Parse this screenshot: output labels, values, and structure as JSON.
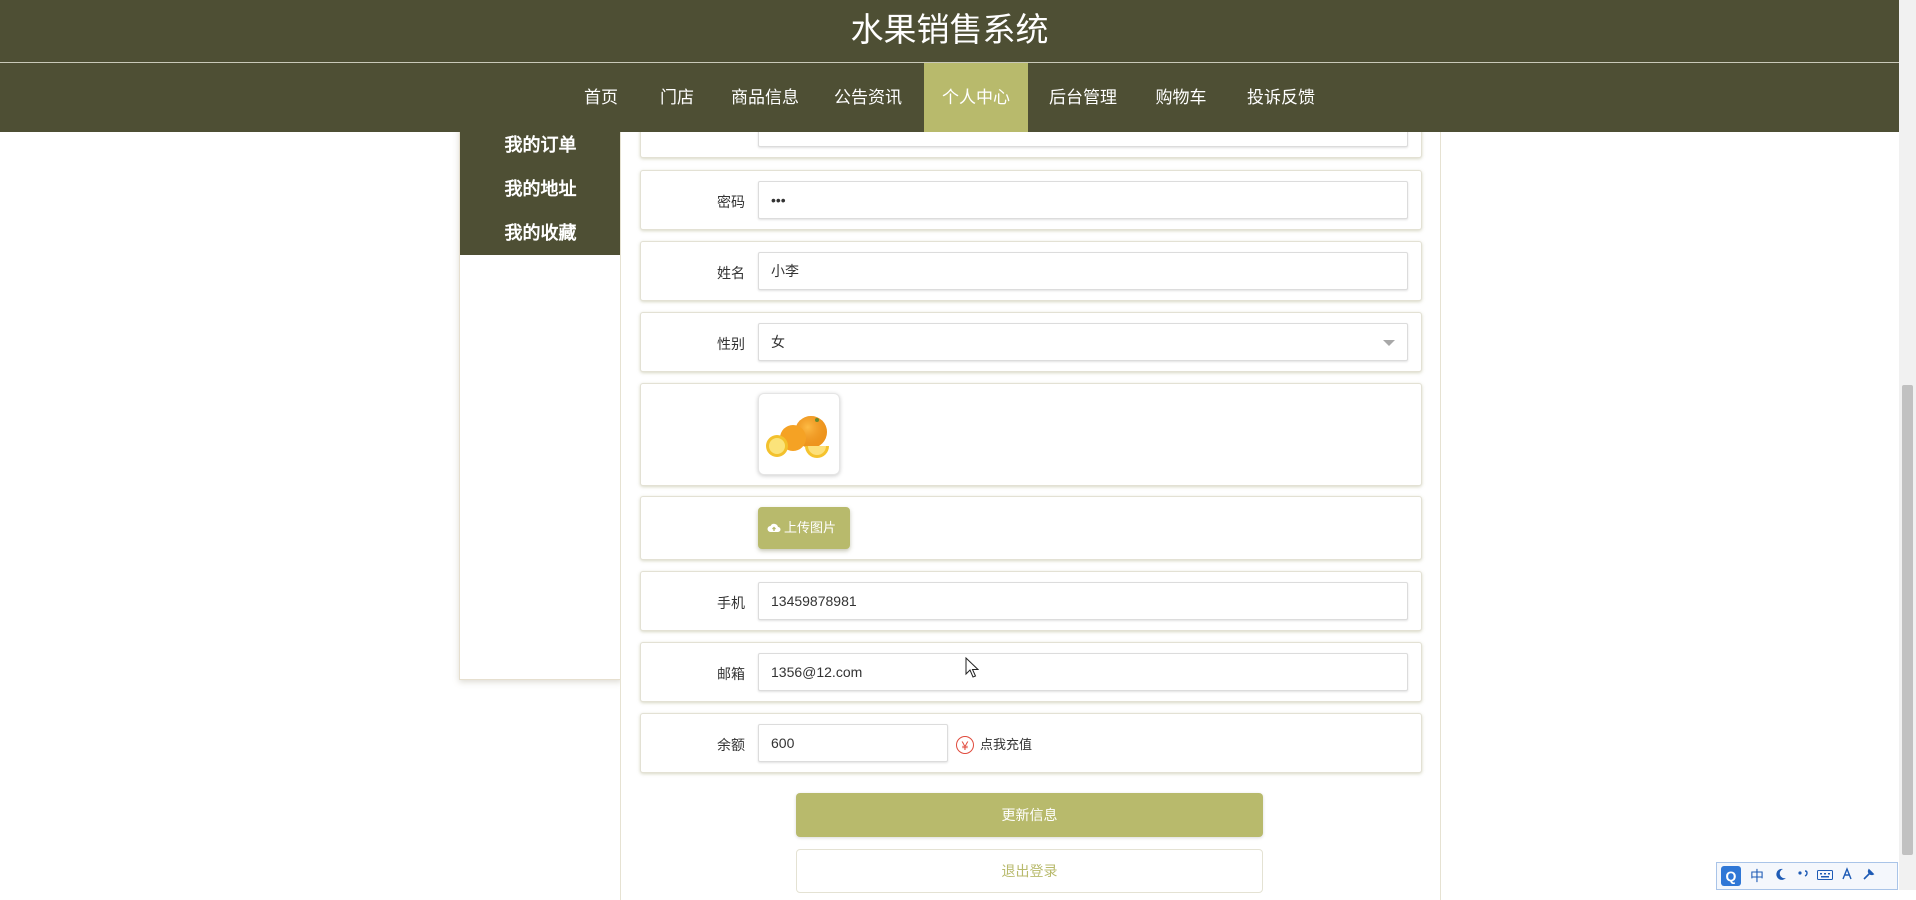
{
  "header": {
    "title": "水果销售系统",
    "nav": [
      {
        "label": "首页"
      },
      {
        "label": "门店"
      },
      {
        "label": "商品信息"
      },
      {
        "label": "公告资讯"
      },
      {
        "label": "个人中心",
        "active": true
      },
      {
        "label": "后台管理"
      },
      {
        "label": "购物车"
      },
      {
        "label": "投诉反馈"
      }
    ]
  },
  "sidebar": {
    "items": [
      {
        "label": "我的订单"
      },
      {
        "label": "我的地址"
      },
      {
        "label": "我的收藏"
      }
    ]
  },
  "form": {
    "password": {
      "label": "密码",
      "value": "•••"
    },
    "name": {
      "label": "姓名",
      "value": "小李"
    },
    "gender": {
      "label": "性别",
      "value": "女"
    },
    "avatar": {
      "icon": "orange-fruit-photo"
    },
    "upload": {
      "label": "上传图片",
      "icon": "cloud-upload-icon"
    },
    "phone": {
      "label": "手机",
      "value": "13459878981"
    },
    "email": {
      "label": "邮箱",
      "value": "1356@12.com"
    },
    "balance": {
      "label": "余额",
      "value": "600",
      "recharge_icon": "¥",
      "recharge_label": "点我充值"
    }
  },
  "actions": {
    "update_label": "更新信息",
    "logout_label": "退出登录"
  },
  "ime": {
    "logo": "Q",
    "mode": "中"
  },
  "colors": {
    "header_bg": "#4e4f34",
    "accent": "#b8ba6c",
    "recharge_red": "#e04a3c"
  }
}
